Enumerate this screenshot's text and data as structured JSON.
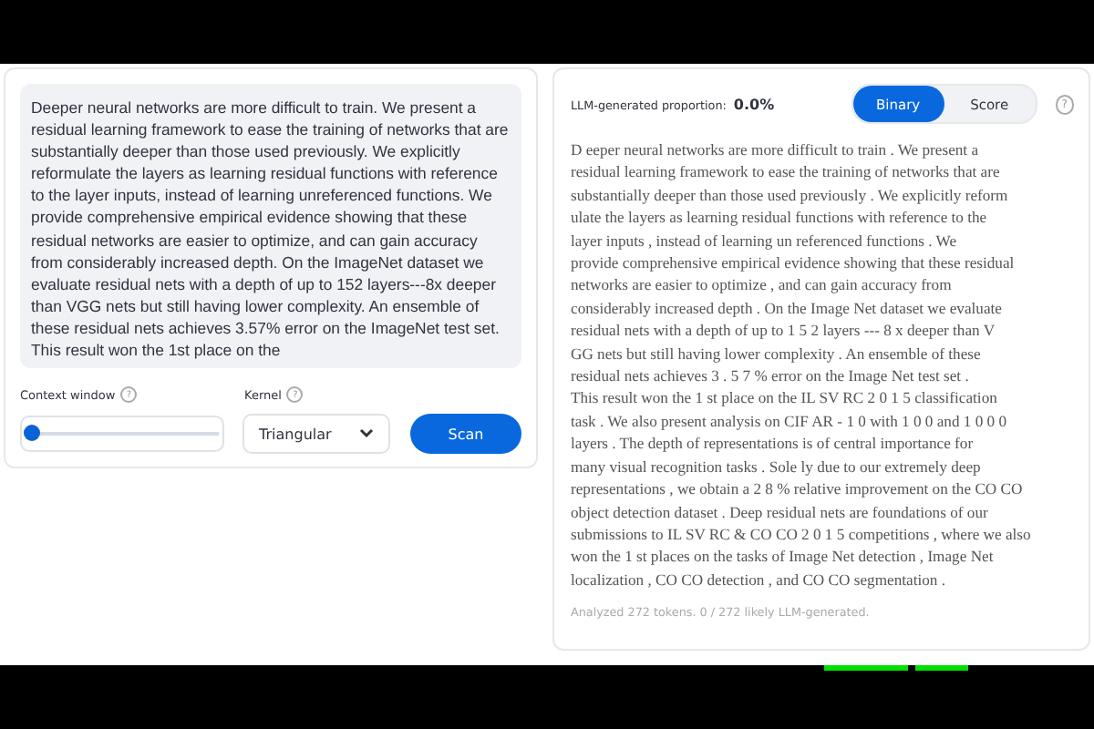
{
  "input": {
    "text": "Deeper neural networks are more difficult to train. We present a residual learning framework to ease the training of networks that are substantially deeper than those used previously. We explicitly reformulate the layers as learning residual functions with reference to the layer inputs, instead of learning unreferenced functions. We provide comprehensive empirical evidence showing that these residual networks are easier to optimize, and can gain accuracy from considerably increased depth. On the ImageNet dataset we evaluate residual nets with a depth of up to 152 layers---8x deeper than VGG nets but still having lower complexity. An ensemble of these residual nets achieves 3.57% error on the ImageNet test set. This result won the 1st place on the"
  },
  "controls": {
    "context_label": "Context window",
    "context_help": "?",
    "context_window": {
      "level": 0.0
    },
    "kernel_label": "Kernel",
    "kernel_help": "?",
    "kernel_value": "Triangular",
    "scan_button": "Scan"
  },
  "result": {
    "proportion_label": "LLM-generated proportion:",
    "proportion_value": "0.0%",
    "modes": [
      {
        "label": "Binary",
        "selected": true
      },
      {
        "label": "Score",
        "selected": false
      }
    ],
    "help": "?",
    "lines": [
      "D eeper neural networks are more difficult to train . We present a",
      "residual learning framework to ease the training of networks that are",
      "substantially deeper than those used previously . We explicitly reform",
      "ulate the layers as learning residual functions with reference to the",
      "layer inputs , instead of learning un referenced functions . We",
      "provide comprehensive empirical evidence showing that these residual",
      "networks are easier to optimize , and can gain accuracy from",
      "considerably increased depth . On the Image Net dataset we evaluate",
      "residual nets with a depth of up to 1 5 2 layers --- 8 x deeper than V",
      "GG nets but still having lower complexity . An ensemble of these",
      "residual nets achieves 3 . 5 7 % error on the Image Net test set .",
      "This result won the 1 st place on the IL SV RC 2 0 1 5 classification",
      "task . We also present analysis on CIF AR - 1 0 with 1 0 0 and 1 0 0 0",
      "layers . The depth of representations is of central importance for",
      "many visual recognition tasks . Sole ly due to our extremely deep",
      "representations , we obtain a 2 8 % relative improvement on the CO CO",
      "object detection dataset . Deep residual nets are foundations of our",
      "submissions to IL SV RC & CO CO 2 0 1 5 competitions , where we also",
      "won the 1 st places on the tasks of Image Net detection , Image Net",
      "localization , CO CO detection , and CO CO segmentation ."
    ],
    "summary": "Analyzed 272 tokens. 0 / 272 likely LLM-generated."
  }
}
